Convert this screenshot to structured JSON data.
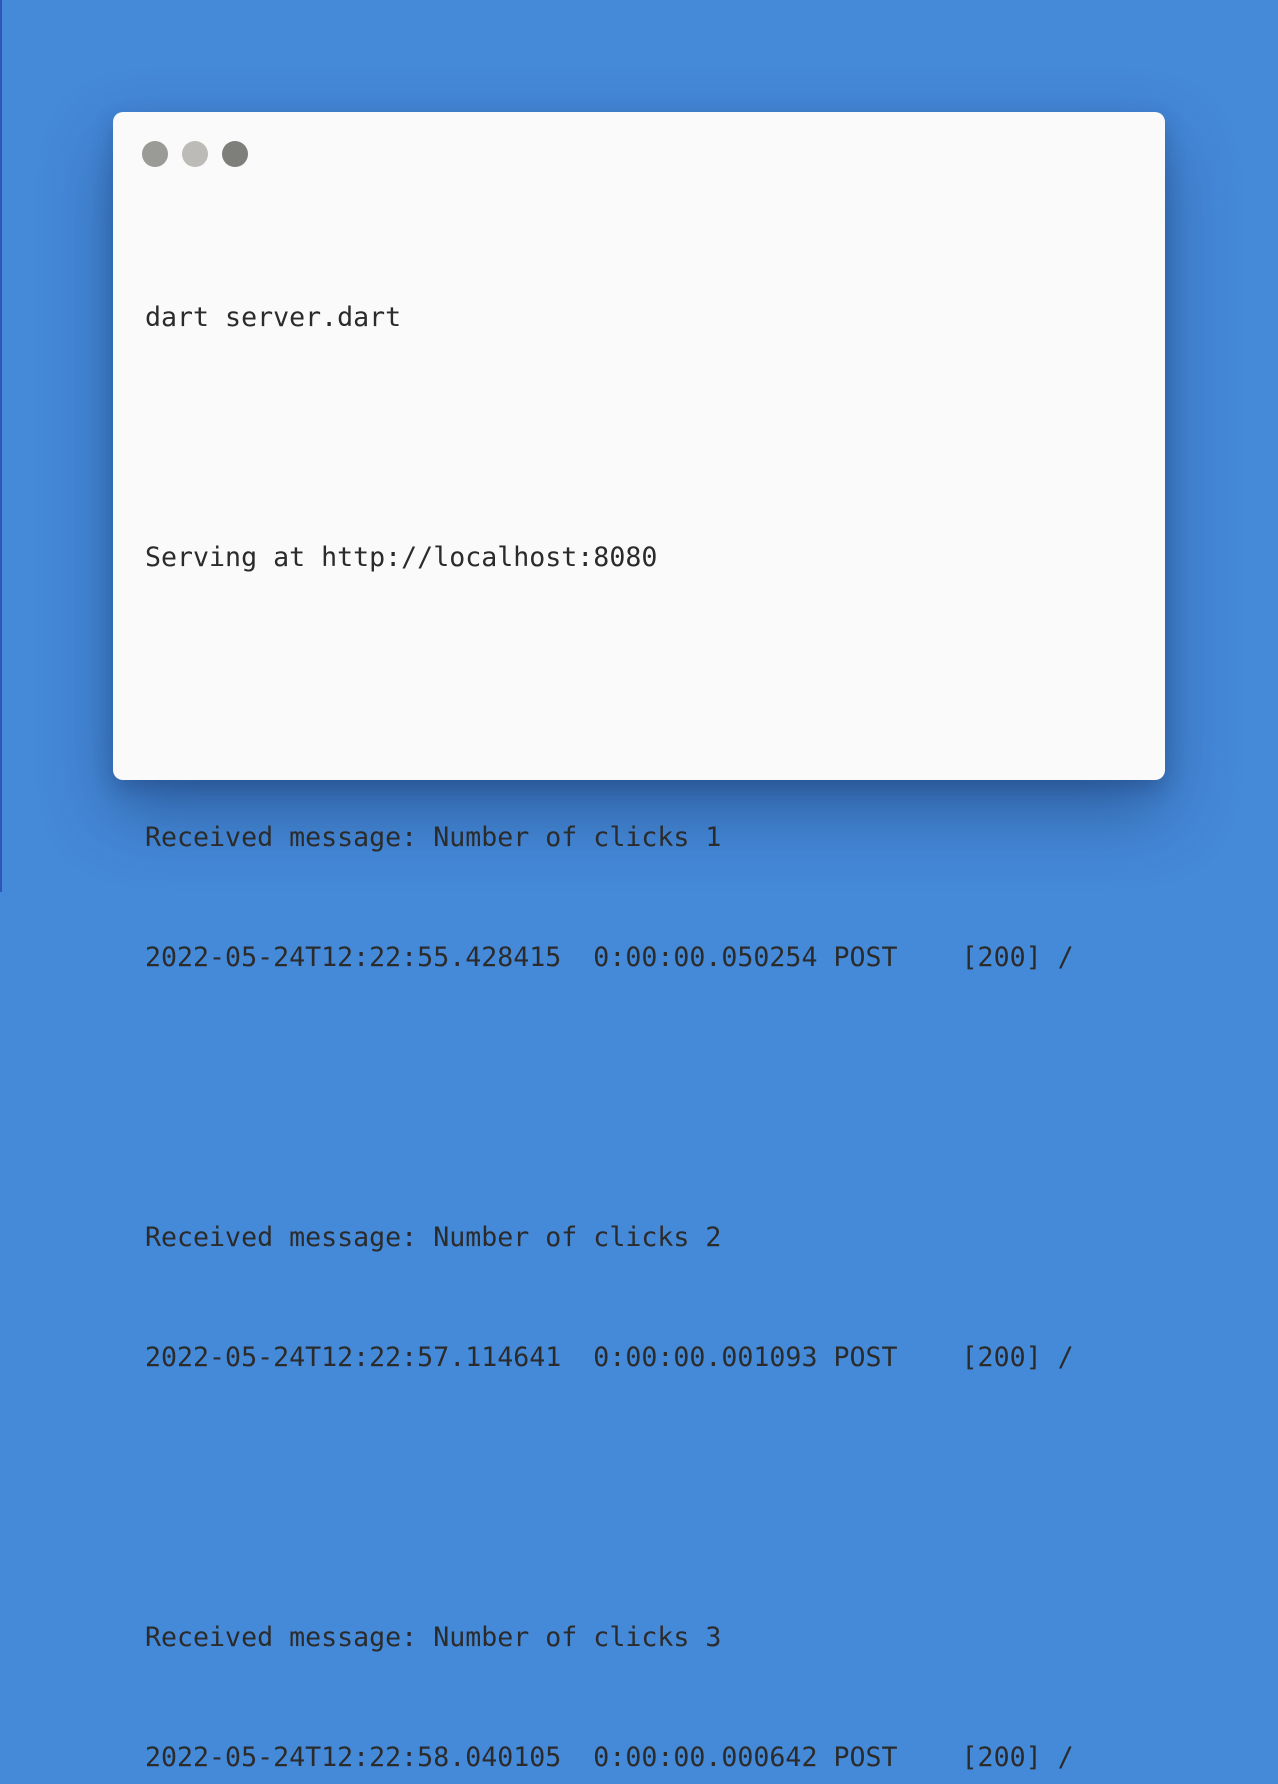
{
  "window": {
    "controls": [
      {
        "name": "close-dot",
        "color": "#9a9a97"
      },
      {
        "name": "minimize-dot",
        "color": "#bdbbb7"
      },
      {
        "name": "zoom-dot",
        "color": "#7e7e7b"
      }
    ]
  },
  "terminal": {
    "command": "dart server.dart",
    "serving": "Serving at http://localhost:8080",
    "entries": [
      {
        "message": "Received message: Number of clicks 1",
        "log": "2022-05-24T12:22:55.428415  0:00:00.050254 POST    [200] /"
      },
      {
        "message": "Received message: Number of clicks 2",
        "log": "2022-05-24T12:22:57.114641  0:00:00.001093 POST    [200] /"
      },
      {
        "message": "Received message: Number of clicks 3",
        "log": "2022-05-24T12:22:58.040105  0:00:00.000642 POST    [200] /"
      }
    ]
  }
}
